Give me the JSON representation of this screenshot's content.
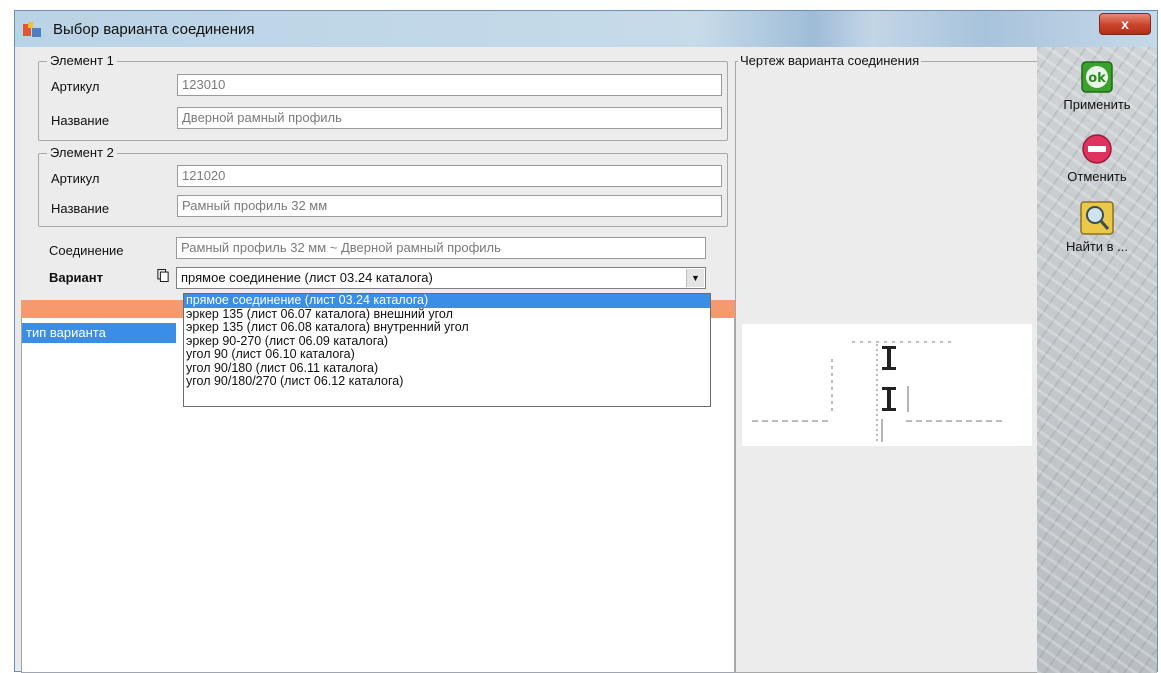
{
  "window": {
    "title": "Выбор варианта соединения",
    "close_label": "x"
  },
  "element1": {
    "legend": "Элемент 1",
    "article_label": "Артикул",
    "article_value": "123010",
    "name_label": "Название",
    "name_value": "Дверной рамный профиль"
  },
  "element2": {
    "legend": "Элемент 2",
    "article_label": "Артикул",
    "article_value": "121020",
    "name_label": "Название",
    "name_value": "Рамный профиль 32 мм"
  },
  "connection": {
    "label": "Соединение",
    "value": "Рамный профиль 32 мм ~ Дверной рамный профиль"
  },
  "variant": {
    "label": "Вариант",
    "selected": "прямое соединение (лист 03.24 каталога)",
    "options": [
      "прямое соединение (лист 03.24 каталога)",
      "эркер 135 (лист 06.07 каталога) внешний угол",
      "эркер 135 (лист 06.08 каталога) внутренний угол",
      "эркер 90-270 (лист 06.09 каталога)",
      "угол 90 (лист 06.10 каталога)",
      "угол 90/180 (лист 06.11 каталога)",
      "угол 90/180/270 (лист 06.12 каталога)"
    ]
  },
  "list": {
    "header": "тип варианта"
  },
  "drawing": {
    "legend": "Чертеж варианта соединения"
  },
  "actions": {
    "apply": "Применить",
    "apply_icon_text": "ok",
    "cancel": "Отменить",
    "find": "Найти в ..."
  }
}
